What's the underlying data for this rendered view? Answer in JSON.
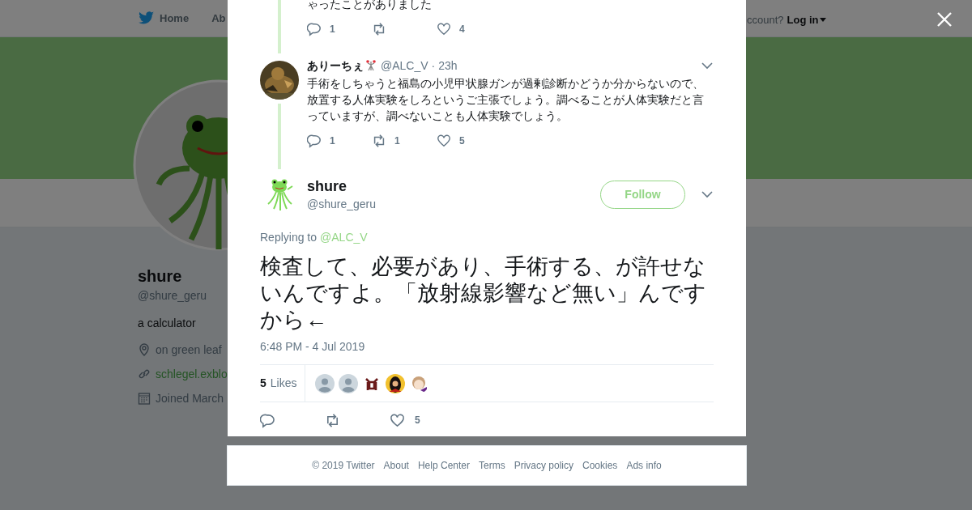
{
  "background_page": {
    "nav": {
      "items": [
        {
          "label": "Home",
          "kind": "home"
        },
        {
          "label": "Ab",
          "kind": "plain"
        }
      ],
      "login_prompt": "ccount?",
      "login": "Log in"
    },
    "profile": {
      "name": "shure",
      "handle": "@shure_geru",
      "bio": "a calculator",
      "location": "on green leaf",
      "url": "schlegel.exblo",
      "joined": "Joined March"
    }
  },
  "dialog": {
    "thread": [
      {
        "text": "ゃったことがありました",
        "actions": [
          {
            "kind": "reply",
            "count": "1"
          },
          {
            "kind": "retweet"
          },
          {
            "kind": "like",
            "count": "4"
          }
        ]
      },
      {
        "name": "ありーちぇ",
        "handle": "@ALC_V",
        "separator": "·",
        "time": "23h",
        "text": "手術をしちゃうと福島の小児甲状腺ガンが過剰診断かどうか分からないので、放置する人体実験をしろというご主張でしょう。調べることが人体実験だと言っていますが、調べないことも人体実験でしょう。",
        "actions": [
          {
            "kind": "reply",
            "count": "1"
          },
          {
            "kind": "retweet",
            "count": "1"
          },
          {
            "kind": "like",
            "count": "5"
          }
        ]
      }
    ],
    "main_tweet": {
      "name": "shure",
      "handle": "@shure_geru",
      "follow_button": "Follow",
      "replying_label": "Replying to",
      "replying_handle": "@ALC_V",
      "text": "検査して、必要があり、手術する、が許せないんですよ。「放射線影響など無い」んですから←",
      "timestamp": "6:48 PM - 4 Jul 2019",
      "likes_count": "5",
      "likes_label": "Likes",
      "likers": [
        {
          "kind": "default"
        },
        {
          "kind": "default"
        },
        {
          "kind": "custom"
        },
        {
          "kind": "custom"
        },
        {
          "kind": "custom"
        }
      ],
      "actions": [
        {
          "kind": "reply"
        },
        {
          "kind": "retweet"
        },
        {
          "kind": "like",
          "count": "5"
        }
      ]
    },
    "footer": [
      "© 2019 Twitter",
      "About",
      "Help Center",
      "Terms",
      "Privacy policy",
      "Cookies",
      "Ads info"
    ]
  }
}
